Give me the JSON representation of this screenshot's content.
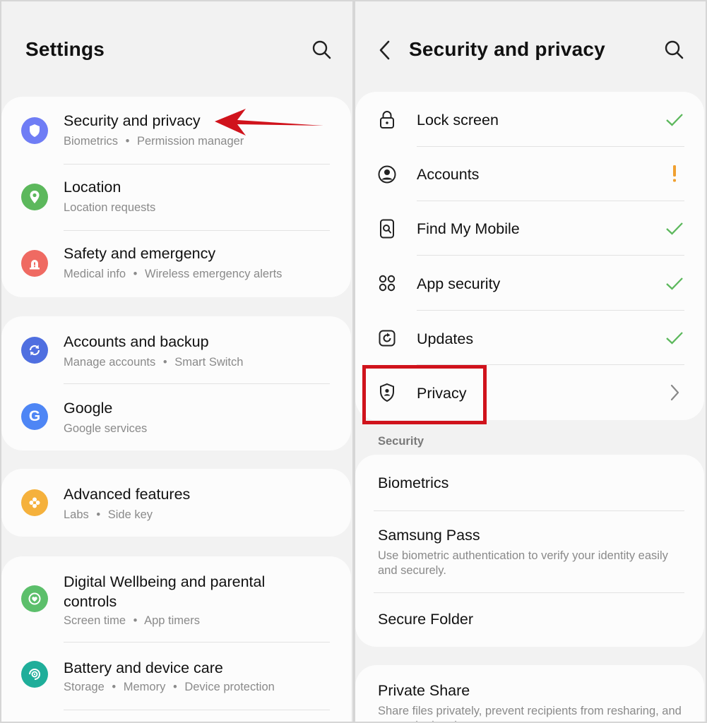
{
  "left": {
    "title": "Settings",
    "groups": [
      {
        "items": [
          {
            "title": "Security and privacy",
            "subtitle": [
              "Biometrics",
              "Permission manager"
            ],
            "icon": "shield-icon",
            "color": "#6f7df5"
          },
          {
            "title": "Location",
            "subtitle": [
              "Location requests"
            ],
            "icon": "location-pin-icon",
            "color": "#5cb85c"
          },
          {
            "title": "Safety and emergency",
            "subtitle": [
              "Medical info",
              "Wireless emergency alerts"
            ],
            "icon": "emergency-alert-icon",
            "color": "#ef6a62"
          }
        ]
      },
      {
        "items": [
          {
            "title": "Accounts and backup",
            "subtitle": [
              "Manage accounts",
              "Smart Switch"
            ],
            "icon": "sync-icon",
            "color": "#4f6fe0"
          },
          {
            "title": "Google",
            "subtitle": [
              "Google services"
            ],
            "icon": "google-icon",
            "color": "#4e86f5"
          }
        ]
      },
      {
        "items": [
          {
            "title": "Advanced features",
            "subtitle": [
              "Labs",
              "Side key"
            ],
            "icon": "puzzle-gear-icon",
            "color": "#f5b13c"
          }
        ]
      },
      {
        "items": [
          {
            "title": "Digital Wellbeing and parental controls",
            "title_lines": [
              "Digital Wellbeing and parental",
              "controls"
            ],
            "subtitle": [
              "Screen time",
              "App timers"
            ],
            "icon": "wellbeing-heart-icon",
            "color": "#5cbf6b"
          },
          {
            "title": "Battery and device care",
            "subtitle": [
              "Storage",
              "Memory",
              "Device protection"
            ],
            "icon": "device-care-icon",
            "color": "#1fae9a"
          }
        ]
      }
    ]
  },
  "right": {
    "title": "Security and privacy",
    "items": [
      {
        "title": "Lock screen",
        "icon": "lock-icon",
        "status": "check"
      },
      {
        "title": "Accounts",
        "icon": "account-circle-icon",
        "status": "warning"
      },
      {
        "title": "Find My Mobile",
        "icon": "find-mobile-icon",
        "status": "check"
      },
      {
        "title": "App security",
        "icon": "app-grid-icon",
        "status": "check"
      },
      {
        "title": "Updates",
        "icon": "update-icon",
        "status": "check"
      },
      {
        "title": "Privacy",
        "icon": "privacy-shield-icon",
        "status": "chevron"
      }
    ],
    "security_label": "Security",
    "security_items": [
      {
        "title": "Biometrics"
      },
      {
        "title": "Samsung Pass",
        "subtitle": "Use biometric authentication to verify your identity easily and securely."
      },
      {
        "title": "Secure Folder"
      }
    ],
    "bottom_items": [
      {
        "title": "Private Share",
        "subtitle": "Share files privately, prevent recipients from resharing, and set expiration dates."
      }
    ]
  },
  "colors": {
    "check": "#5cb85c",
    "warning": "#f0a030",
    "annotation": "#d0131c"
  },
  "separator": "•"
}
